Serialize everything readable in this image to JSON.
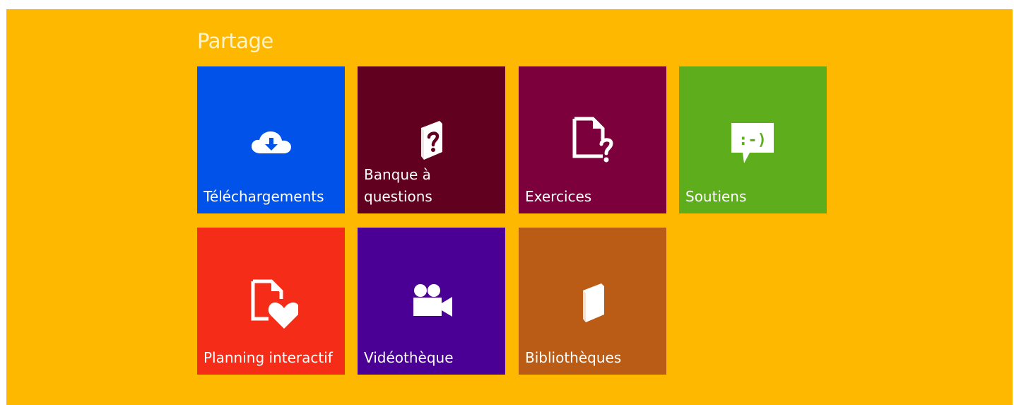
{
  "section": {
    "title": "Partage"
  },
  "colors": {
    "background": "#FFB800",
    "title": "#FFF3C9"
  },
  "tiles": [
    {
      "label": "Téléchargements",
      "icon": "cloud-download-icon",
      "color": "#0052E8"
    },
    {
      "label": "Banque à questions",
      "icon": "question-book-icon",
      "color": "#62001F"
    },
    {
      "label": "Exercices",
      "icon": "document-question-icon",
      "color": "#7C003C"
    },
    {
      "label": "Soutiens",
      "icon": "smiley-speech-bubble-icon",
      "color": "#5EAD1C"
    },
    {
      "label": "Planning interactif",
      "icon": "document-heart-icon",
      "color": "#F42C18"
    },
    {
      "label": "Vidéothèque",
      "icon": "video-camera-icon",
      "color": "#4A0094"
    },
    {
      "label": "Bibliothèques",
      "icon": "book-icon",
      "color": "#BA5B16"
    }
  ]
}
